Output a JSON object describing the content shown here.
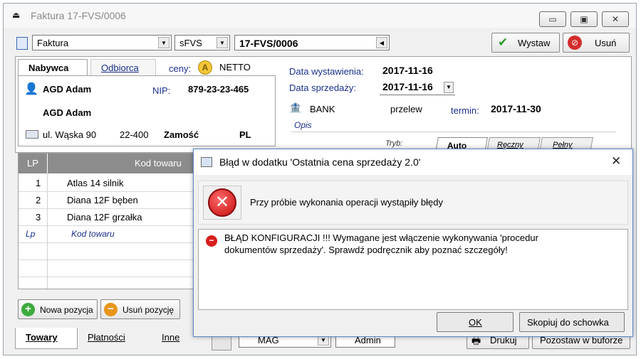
{
  "window": {
    "title": "Faktura 17-FVS/0006",
    "min_glyph": "▭",
    "max_glyph": "▣",
    "close_glyph": "✕"
  },
  "toolbar": {
    "doc_type": "Faktura",
    "series": "sFVS",
    "number": "17-FVS/0006",
    "issue_label": "Wystaw",
    "delete_label": "Usuń"
  },
  "buyer": {
    "tab_buyer": "Nabywca",
    "tab_recipient": "Odbiorca",
    "prices_label": "ceny:",
    "prices_badge": "A",
    "prices_value": "NETTO",
    "name": "AGD Adam",
    "nip_label": "NIP:",
    "nip": "879-23-23-465",
    "name2": "AGD Adam",
    "street": "ul. Wąska 90",
    "postcode": "22-400",
    "city": "Zamość",
    "country": "PL"
  },
  "dates": {
    "issue_label": "Data wystawienia:",
    "issue_value": "2017-11-16",
    "sale_label": "Data sprzedaży:",
    "sale_value": "2017-11-16",
    "bank": "BANK",
    "payment": "przelew",
    "term_label": "termin:",
    "term_value": "2017-11-30",
    "desc_label": "Opis",
    "mode_label": "Tryb:",
    "modes": [
      "Auto",
      "Ręczny",
      "Pełny"
    ]
  },
  "grid": {
    "col_lp": "LP",
    "col_code": "Kod towaru",
    "rows": [
      {
        "lp": "1",
        "code": "Atlas 14 silnik"
      },
      {
        "lp": "2",
        "code": "Diana 12F bęben"
      },
      {
        "lp": "3",
        "code": "Diana 12F grzałka"
      }
    ],
    "new_lp": "Lp",
    "new_code": "Kod towaru"
  },
  "actions": {
    "add_label": "Nowa pozycja",
    "remove_label": "Usuń pozycję"
  },
  "bottom_tabs": [
    "Towary",
    "Płatności",
    "Inne"
  ],
  "bottom_bar": {
    "warehouse": "MAG",
    "user": "Admin",
    "print_label": "Drukuj",
    "leave_label": "Pozostaw w buforze"
  },
  "dialog": {
    "title": "Błąd w dodatku 'Ostatnia cena sprzedaży 2.0'",
    "header_msg": "Przy próbie wykonania operacji wystąpiły błędy",
    "error_line1": "BŁĄD KONFIGURACJI !!! Wymagane jest włączenie wykonywania 'procedur",
    "error_line2": "dokumentów sprzedaży'. Sprawdź podręcznik aby poznać szczegóły!",
    "ok_label": "OK",
    "copy_label": "Skopiuj do schowka",
    "close_glyph": "✕"
  }
}
